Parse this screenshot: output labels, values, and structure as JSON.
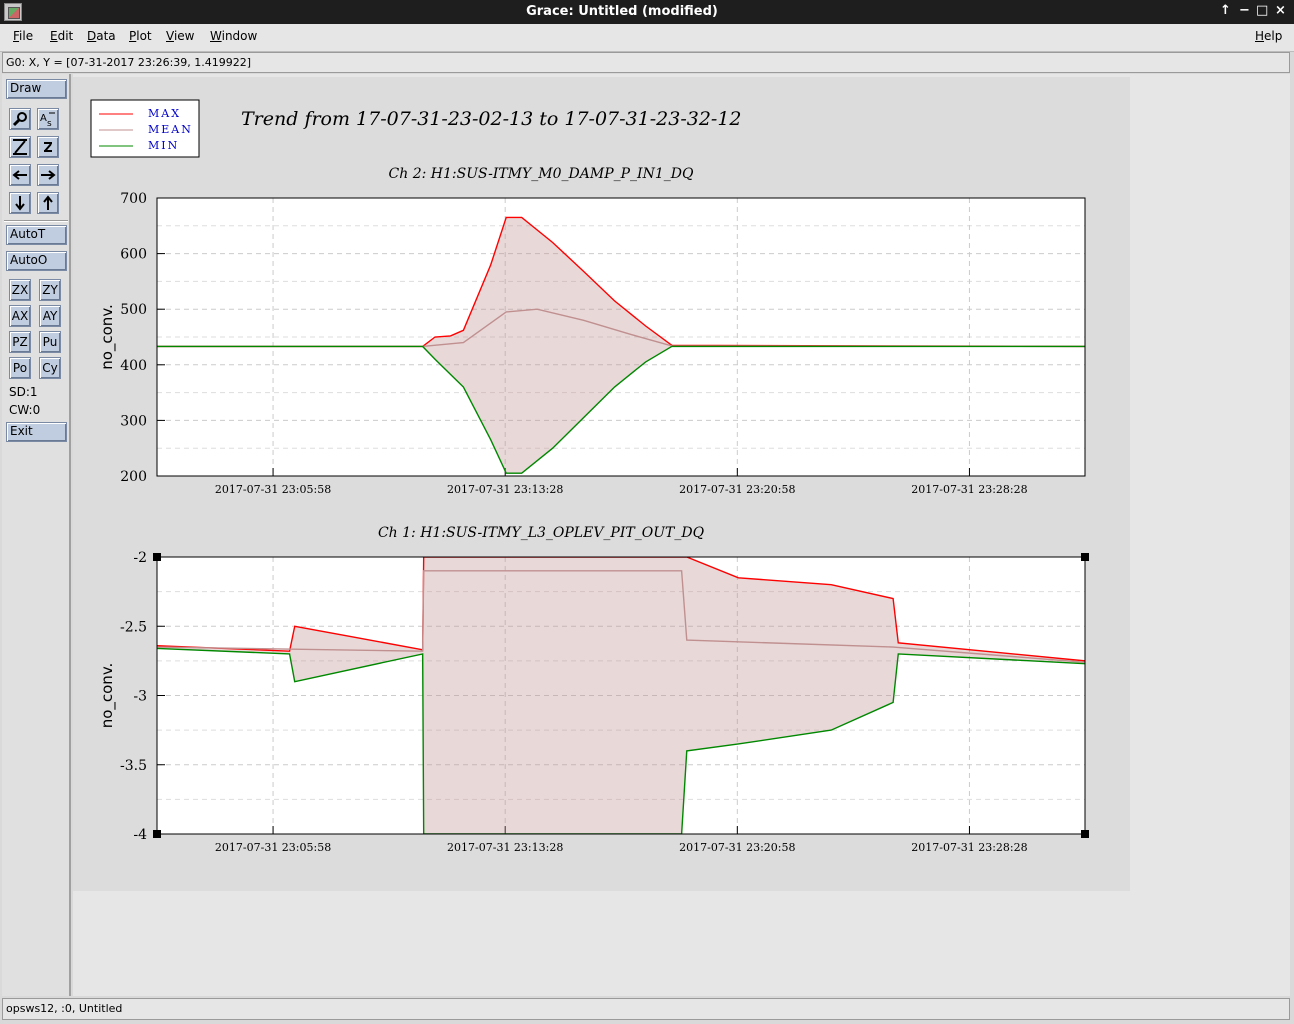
{
  "window": {
    "title": "Grace: Untitled (modified)",
    "controls": [
      "↑",
      "−",
      "□",
      "×"
    ]
  },
  "menu": {
    "items": [
      "File",
      "Edit",
      "Data",
      "Plot",
      "View",
      "Window"
    ],
    "help": "Help"
  },
  "locator": "G0: X, Y = [07-31-2017 23:26:39, 1.419922]",
  "toolbar": {
    "draw": "Draw",
    "autot": "AutoT",
    "autoo": "AutoO",
    "zx": "ZX",
    "zy": "ZY",
    "ax": "AX",
    "ay": "AY",
    "pz": "PZ",
    "pu": "Pu",
    "po": "Po",
    "cy": "Cy",
    "sd": "SD:1",
    "cw": "CW:0",
    "exit": "Exit",
    "icons": [
      "zoom-icon",
      "autoscale-text-icon",
      "zoom-in-icon",
      "zoom-out-icon",
      "left-arrow-icon",
      "right-arrow-icon",
      "down-arrow-icon",
      "up-arrow-icon"
    ]
  },
  "status": "opsws12, :0, Untitled",
  "colors": {
    "max": "#ff0000",
    "mean": "#c09090",
    "min": "#008800",
    "text": "#0000cc"
  },
  "plot": {
    "title": "Trend from 17-07-31-23-02-13 to 17-07-31-23-32-12",
    "legend": [
      "MAX",
      "MEAN",
      "MIN"
    ]
  },
  "chart_data": [
    {
      "type": "line",
      "title": "Ch 2: H1:SUS-ITMY_M0_DAMP_P_IN1_DQ",
      "ylabel": "no_conv.",
      "xlim": [
        "2017-07-31 23:02:13",
        "2017-07-31 23:32:12"
      ],
      "ylim": [
        200,
        700
      ],
      "yticks": [
        "700",
        "600",
        "500",
        "400",
        "300",
        "200"
      ],
      "xticks": [
        "2017-07-31 23:05:58",
        "2017-07-31 23:13:28",
        "2017-07-31 23:20:58",
        "2017-07-31 23:28:28"
      ],
      "grid": true,
      "series": [
        {
          "name": "MAX",
          "points": [
            [
              "2017-07-31 23:02:13",
              433
            ],
            [
              "2017-07-31 23:10:48",
              433
            ],
            [
              "2017-07-31 23:11:12",
              450
            ],
            [
              "2017-07-31 23:11:42",
              452
            ],
            [
              "2017-07-31 23:12:07",
              462
            ],
            [
              "2017-07-31 23:13:00",
              580
            ],
            [
              "2017-07-31 23:13:30",
              665
            ],
            [
              "2017-07-31 23:14:00",
              665
            ],
            [
              "2017-07-31 23:15:00",
              620
            ],
            [
              "2017-07-31 23:16:00",
              568
            ],
            [
              "2017-07-31 23:17:00",
              515
            ],
            [
              "2017-07-31 23:18:00",
              470
            ],
            [
              "2017-07-31 23:18:51",
              435
            ],
            [
              "2017-07-31 23:25:53",
              434
            ],
            [
              "2017-07-31 23:32:12",
              433
            ]
          ]
        },
        {
          "name": "MEAN",
          "points": [
            [
              "2017-07-31 23:02:13",
              433
            ],
            [
              "2017-07-31 23:10:48",
              433
            ],
            [
              "2017-07-31 23:12:07",
              440
            ],
            [
              "2017-07-31 23:13:30",
              495
            ],
            [
              "2017-07-31 23:14:30",
              500
            ],
            [
              "2017-07-31 23:16:00",
              480
            ],
            [
              "2017-07-31 23:17:30",
              455
            ],
            [
              "2017-07-31 23:18:51",
              434
            ],
            [
              "2017-07-31 23:32:12",
              433
            ]
          ]
        },
        {
          "name": "MIN",
          "points": [
            [
              "2017-07-31 23:02:13",
              433
            ],
            [
              "2017-07-31 23:10:48",
              433
            ],
            [
              "2017-07-31 23:11:12",
              410
            ],
            [
              "2017-07-31 23:12:07",
              360
            ],
            [
              "2017-07-31 23:13:00",
              265
            ],
            [
              "2017-07-31 23:13:30",
              205
            ],
            [
              "2017-07-31 23:14:00",
              205
            ],
            [
              "2017-07-31 23:15:00",
              250
            ],
            [
              "2017-07-31 23:16:00",
              305
            ],
            [
              "2017-07-31 23:17:00",
              360
            ],
            [
              "2017-07-31 23:18:00",
              405
            ],
            [
              "2017-07-31 23:18:51",
              433
            ],
            [
              "2017-07-31 23:32:12",
              433
            ]
          ]
        }
      ]
    },
    {
      "type": "line",
      "title": "Ch 1: H1:SUS-ITMY_L3_OPLEV_PIT_OUT_DQ",
      "ylabel": "no_conv.",
      "xlim": [
        "2017-07-31 23:02:13",
        "2017-07-31 23:32:12"
      ],
      "ylim": [
        -4,
        -2
      ],
      "yticks": [
        "-2",
        "-2.5",
        "-3",
        "-3.5",
        "-4"
      ],
      "xticks": [
        "2017-07-31 23:05:58",
        "2017-07-31 23:13:28",
        "2017-07-31 23:20:58",
        "2017-07-31 23:28:28"
      ],
      "grid": true,
      "series": [
        {
          "name": "MAX",
          "points": [
            [
              "2017-07-31 23:02:13",
              -2.64
            ],
            [
              "2017-07-31 23:06:30",
              -2.68
            ],
            [
              "2017-07-31 23:06:40",
              -2.5
            ],
            [
              "2017-07-31 23:10:48",
              -2.67
            ],
            [
              "2017-07-31 23:10:50",
              -2.0
            ],
            [
              "2017-07-31 23:19:10",
              -2.0
            ],
            [
              "2017-07-31 23:19:20",
              -2.0
            ],
            [
              "2017-07-31 23:21:00",
              -2.15
            ],
            [
              "2017-07-31 23:24:00",
              -2.2
            ],
            [
              "2017-07-31 23:26:00",
              -2.3
            ],
            [
              "2017-07-31 23:26:10",
              -2.62
            ],
            [
              "2017-07-31 23:32:12",
              -2.75
            ]
          ]
        },
        {
          "name": "MEAN",
          "points": [
            [
              "2017-07-31 23:02:13",
              -2.65
            ],
            [
              "2017-07-31 23:10:48",
              -2.68
            ],
            [
              "2017-07-31 23:10:50",
              -2.1
            ],
            [
              "2017-07-31 23:19:10",
              -2.1
            ],
            [
              "2017-07-31 23:19:20",
              -2.6
            ],
            [
              "2017-07-31 23:26:00",
              -2.65
            ],
            [
              "2017-07-31 23:32:12",
              -2.76
            ]
          ]
        },
        {
          "name": "MIN",
          "points": [
            [
              "2017-07-31 23:02:13",
              -2.66
            ],
            [
              "2017-07-31 23:06:30",
              -2.7
            ],
            [
              "2017-07-31 23:06:40",
              -2.9
            ],
            [
              "2017-07-31 23:10:48",
              -2.7
            ],
            [
              "2017-07-31 23:10:50",
              -4.0
            ],
            [
              "2017-07-31 23:19:10",
              -4.0
            ],
            [
              "2017-07-31 23:19:20",
              -3.4
            ],
            [
              "2017-07-31 23:21:00",
              -3.35
            ],
            [
              "2017-07-31 23:24:00",
              -3.25
            ],
            [
              "2017-07-31 23:26:00",
              -3.05
            ],
            [
              "2017-07-31 23:26:10",
              -2.7
            ],
            [
              "2017-07-31 23:32:12",
              -2.77
            ]
          ]
        }
      ]
    }
  ]
}
